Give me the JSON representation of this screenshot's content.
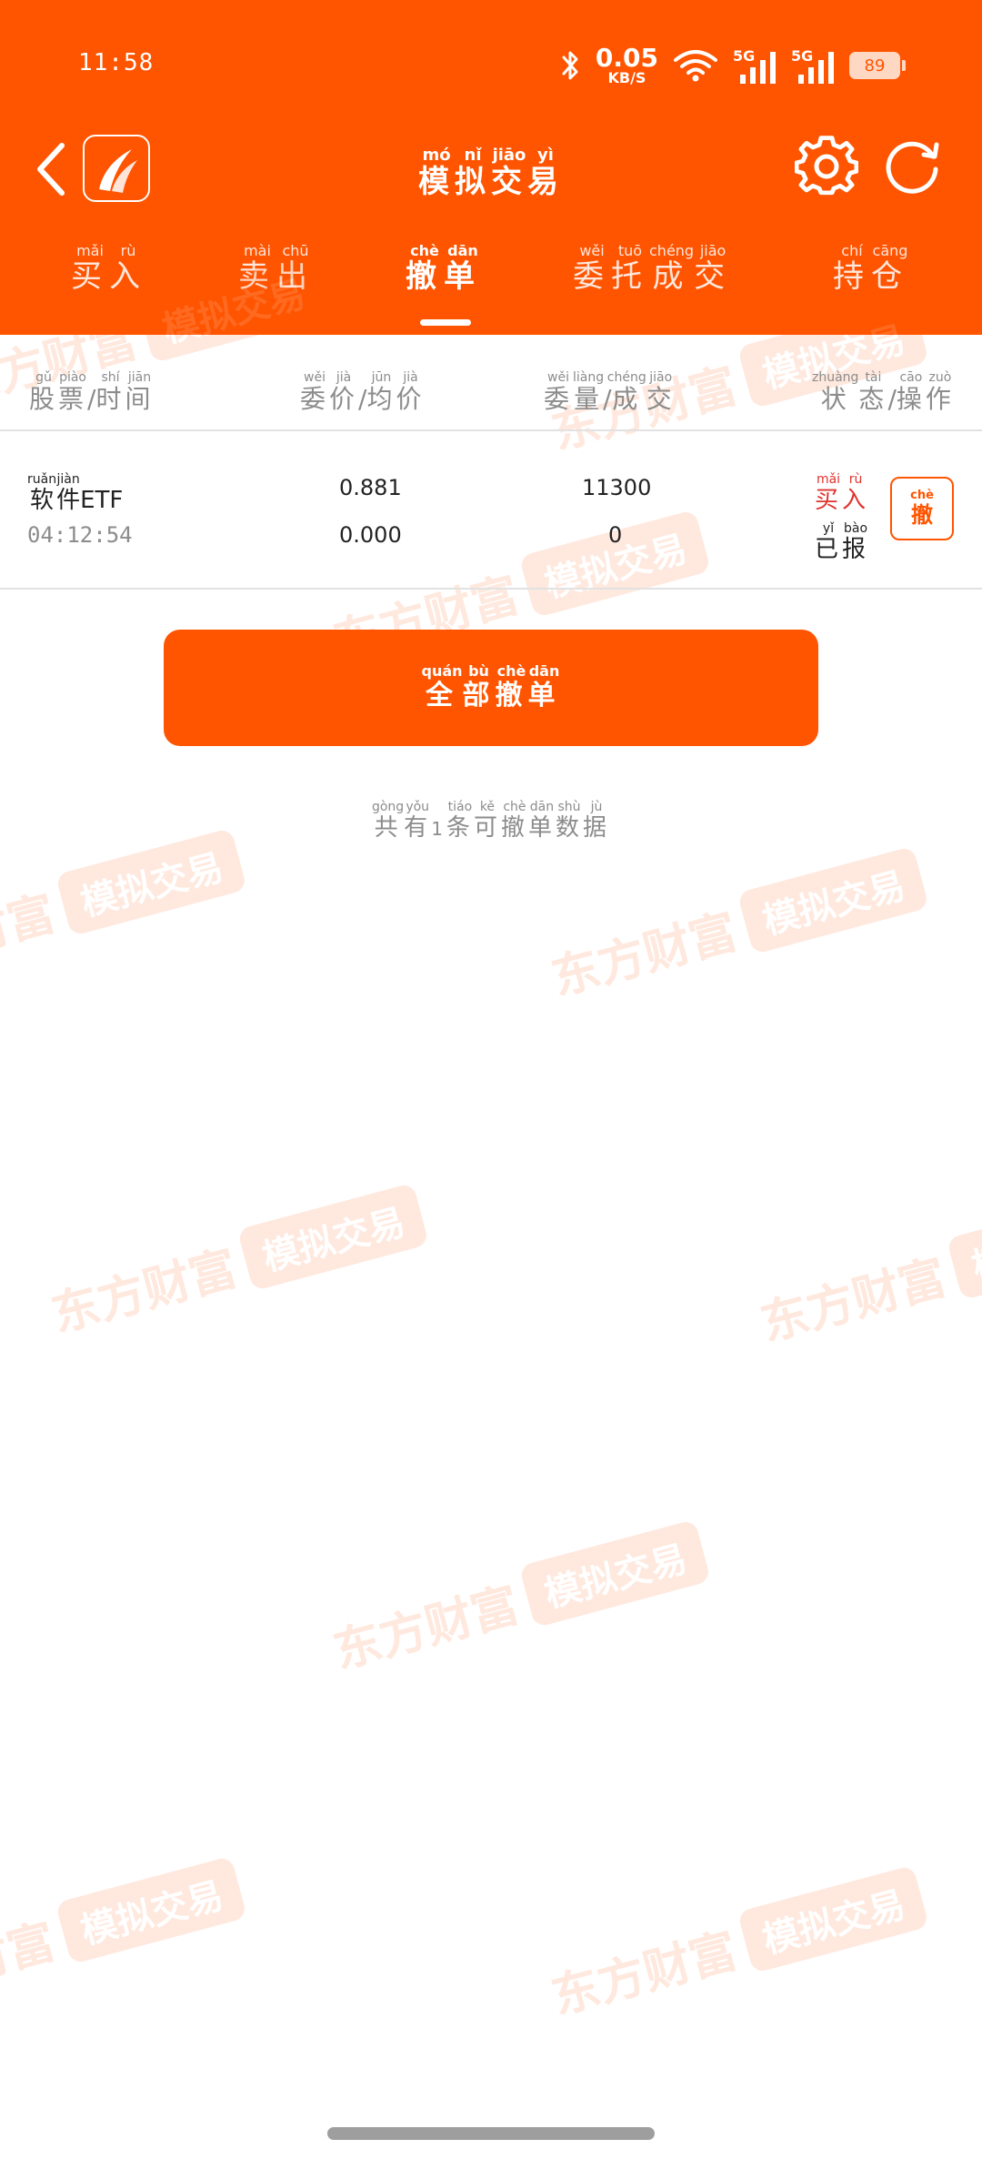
{
  "status_bar": {
    "time": "11:58",
    "net_speed": "0.05",
    "net_unit": "KB/S",
    "signal_1_label": "5G",
    "signal_2_label": "5G",
    "battery": "89"
  },
  "header": {
    "title": [
      {
        "char": "模",
        "py": "mó"
      },
      {
        "char": "拟",
        "py": "nǐ"
      },
      {
        "char": "交",
        "py": "jiāo"
      },
      {
        "char": "易",
        "py": "yì"
      }
    ]
  },
  "tabs": [
    {
      "chars": [
        {
          "char": "买",
          "py": "mǎi"
        },
        {
          "char": "入",
          "py": "rù"
        }
      ],
      "active": false
    },
    {
      "chars": [
        {
          "char": "卖",
          "py": "mài"
        },
        {
          "char": "出",
          "py": "chū"
        }
      ],
      "active": false
    },
    {
      "chars": [
        {
          "char": "撤",
          "py": "chè"
        },
        {
          "char": "单",
          "py": "dān"
        }
      ],
      "active": true
    },
    {
      "chars": [
        {
          "char": "委",
          "py": "wěi"
        },
        {
          "char": "托",
          "py": "tuō"
        },
        {
          "char": "成",
          "py": "chéng"
        },
        {
          "char": "交",
          "py": "jiāo"
        }
      ],
      "active": false
    },
    {
      "chars": [
        {
          "char": "持",
          "py": "chí"
        },
        {
          "char": "仓",
          "py": "cāng"
        }
      ],
      "active": false
    }
  ],
  "columns": {
    "col1": {
      "a": [
        {
          "char": "股",
          "py": "gǔ"
        },
        {
          "char": "票",
          "py": "piào"
        }
      ],
      "b": [
        {
          "char": "时",
          "py": "shí"
        },
        {
          "char": "间",
          "py": "jiān"
        }
      ]
    },
    "col2": {
      "a": [
        {
          "char": "委",
          "py": "wěi"
        },
        {
          "char": "价",
          "py": "jià"
        }
      ],
      "b": [
        {
          "char": "均",
          "py": "jūn"
        },
        {
          "char": "价",
          "py": "jià"
        }
      ]
    },
    "col3": {
      "a": [
        {
          "char": "委",
          "py": "wěi"
        },
        {
          "char": "量",
          "py": "liàng"
        }
      ],
      "b": [
        {
          "char": "成",
          "py": "chéng"
        },
        {
          "char": "交",
          "py": "jiāo"
        }
      ]
    },
    "col4": {
      "a": [
        {
          "char": "状",
          "py": "zhuàng"
        },
        {
          "char": "态",
          "py": "tài"
        }
      ],
      "b": [
        {
          "char": "操",
          "py": "cāo"
        },
        {
          "char": "作",
          "py": "zuò"
        }
      ]
    },
    "separator": "/"
  },
  "orders": [
    {
      "name_chars": [
        {
          "char": "软",
          "py": "ruǎn"
        },
        {
          "char": "件",
          "py": "jiàn"
        }
      ],
      "name_suffix": "ETF",
      "time": "04:12:54",
      "order_price": "0.881",
      "avg_price": "0.000",
      "order_qty": "11300",
      "filled_qty": "0",
      "direction": [
        {
          "char": "买",
          "py": "mǎi"
        },
        {
          "char": "入",
          "py": "rù"
        }
      ],
      "state": [
        {
          "char": "已",
          "py": "yǐ"
        },
        {
          "char": "报",
          "py": "bào"
        }
      ],
      "cancel": {
        "char": "撤",
        "py": "chè"
      }
    }
  ],
  "cancel_all": [
    {
      "char": "全",
      "py": "quán"
    },
    {
      "char": "部",
      "py": "bù"
    },
    {
      "char": "撤",
      "py": "chè"
    },
    {
      "char": "单",
      "py": "dān"
    }
  ],
  "summary": {
    "prefix": [
      {
        "char": "共",
        "py": "gòng"
      },
      {
        "char": "有",
        "py": "yǒu"
      }
    ],
    "count": "1",
    "suffix": [
      {
        "char": "条",
        "py": "tiáo"
      },
      {
        "char": "可",
        "py": "kě"
      },
      {
        "char": "撤",
        "py": "chè"
      },
      {
        "char": "单",
        "py": "dān"
      },
      {
        "char": "数",
        "py": "shù"
      },
      {
        "char": "据",
        "py": "jù"
      }
    ]
  },
  "watermark": {
    "brand": "东方财富",
    "badge": "模拟交易"
  },
  "colors": {
    "brand": "#ff5400",
    "buy": "#e0332e",
    "muted": "#8c8c8c"
  }
}
